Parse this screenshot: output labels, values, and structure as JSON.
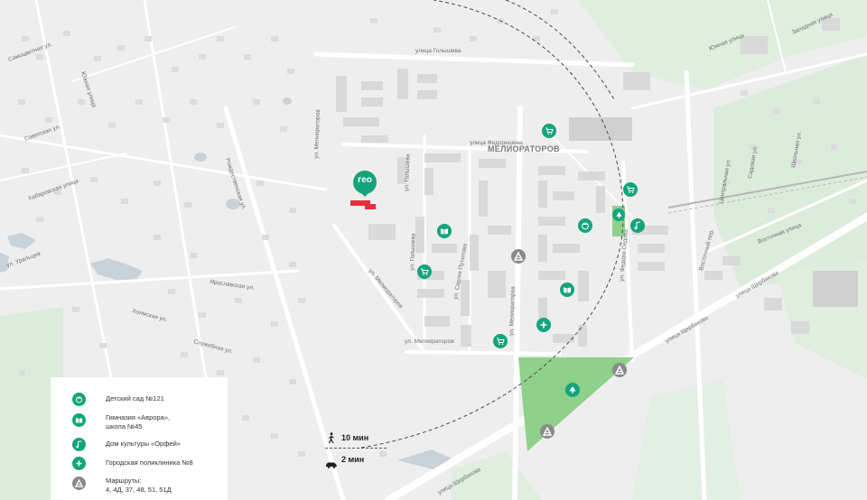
{
  "colors": {
    "accent": "#14a47c",
    "route_stop": "#8a8a8a",
    "park": "#8fd08a",
    "greenery": "#dcecdc",
    "building": "#d8d8d8",
    "road": "#ffffff",
    "water": "#c9d2d8",
    "pin_red": "#e8303c"
  },
  "map": {
    "district_label": "МЕЛИОРАТОРОВ",
    "streets": {
      "golysheva_top": "улица Голышева",
      "golysheva_mid": "ул. Голышева",
      "golysheva_upper": "ул. Голышева",
      "meliorator_ul": "ул. Мелиораторов",
      "meliorator_ul2": "ул. Мелиораторов",
      "meliorator_ulica": "ул. Мелиораторов",
      "fedorishina": "улица Федоришина",
      "sergeya_putilova": "ул. Сергея Путилова",
      "fedora_sedova": "ул. Федора Седова",
      "shcherbakova_1": "улица Щербакова",
      "shcherbakova_2": "улица Щербакова",
      "shcherbakova_3": "улица Щербакова",
      "khabarovskaya": "Хабаровская улица",
      "yuzhnaya": "Южная улица",
      "yuzhnaya2": "Южная улица",
      "zapadnaya": "Западная улица",
      "vostochnaya": "Восточная улица",
      "vostochnaya_lane": "Восточный пер.",
      "tsentralnaya": "Центральная ул.",
      "sadovaya": "Садовая ул.",
      "shkolnaya": "Школьная ул.",
      "uraltsev": "ул. Уральцев",
      "samotsvetnaya": "Самоцветная ул.",
      "sovetskaya": "Советская ул.",
      "kholmskaya": "Холмская ул.",
      "rozhdestvenskaya": "Рождественская ул.",
      "yaroslavskaya": "Ярославская ул.",
      "sluzhebnaya": "Служебная ул.",
      "yuzhnaya_left": "Южная улица",
      "meliorator_top": "ул. Мелиораторов"
    }
  },
  "poi_icons": {
    "kindergarten": "kindergarten-icon",
    "school": "book-icon",
    "culture": "music-note-icon",
    "clinic": "cross-icon",
    "route": "bus-stop-icon",
    "shop": "shopping-cart-icon",
    "park": "tree-icon"
  },
  "legend": {
    "items": [
      {
        "icon": "kindergarten-icon",
        "label": "Детский сад №121"
      },
      {
        "icon": "book-icon",
        "label": "Гимназия «Аврора»,\nшкола №45"
      },
      {
        "icon": "music-note-icon",
        "label": "Дом культуры «Орфей»"
      },
      {
        "icon": "cross-icon",
        "label": "Городская поликлиника №8"
      },
      {
        "icon": "bus-stop-icon",
        "label": "Маршруты:\n4, 4Д, 37, 48, 51, 51Д"
      }
    ]
  },
  "travel_time": {
    "walk": "10 мин",
    "car": "2 мин"
  },
  "logo": {
    "text": "гео"
  }
}
